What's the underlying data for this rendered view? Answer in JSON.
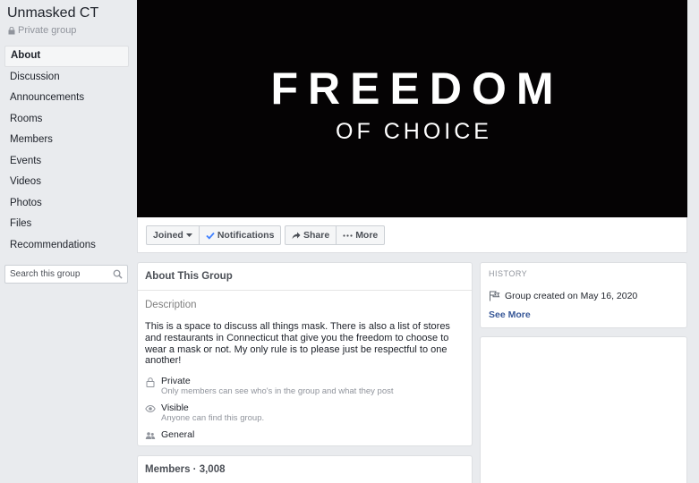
{
  "group": {
    "name": "Unmasked CT",
    "privacy": "Private group"
  },
  "nav": {
    "items": [
      {
        "label": "About",
        "active": true
      },
      {
        "label": "Discussion"
      },
      {
        "label": "Announcements"
      },
      {
        "label": "Rooms"
      },
      {
        "label": "Members"
      },
      {
        "label": "Events"
      },
      {
        "label": "Videos"
      },
      {
        "label": "Photos"
      },
      {
        "label": "Files"
      },
      {
        "label": "Recommendations"
      }
    ]
  },
  "search": {
    "placeholder": "Search this group",
    "icon": "search-icon"
  },
  "cover": {
    "line1": "FREEDOM",
    "line2": "OF CHOICE",
    "background": "#050304",
    "text_color": "#ffffff"
  },
  "actions": {
    "joined": "Joined",
    "notifications": "Notifications",
    "share": "Share",
    "more": "More"
  },
  "about": {
    "header": "About This Group",
    "description_title": "Description",
    "description": "This is a space to discuss all things mask. There is also a list of stores and restaurants in Connecticut that give you the freedom to choose to wear a mask or not. My only rule is to please just be respectful to one another!",
    "private_label": "Private",
    "private_sub": "Only members can see who's in the group and what they post",
    "visible_label": "Visible",
    "visible_sub": "Anyone can find this group.",
    "general_label": "General"
  },
  "members": {
    "title": "Members · 3,008"
  },
  "history": {
    "title": "HISTORY",
    "created": "Group created on May 16, 2020",
    "see_more": "See More"
  },
  "colors": {
    "page_bg": "#e9ebee",
    "link": "#385898",
    "check": "#4080ff"
  }
}
